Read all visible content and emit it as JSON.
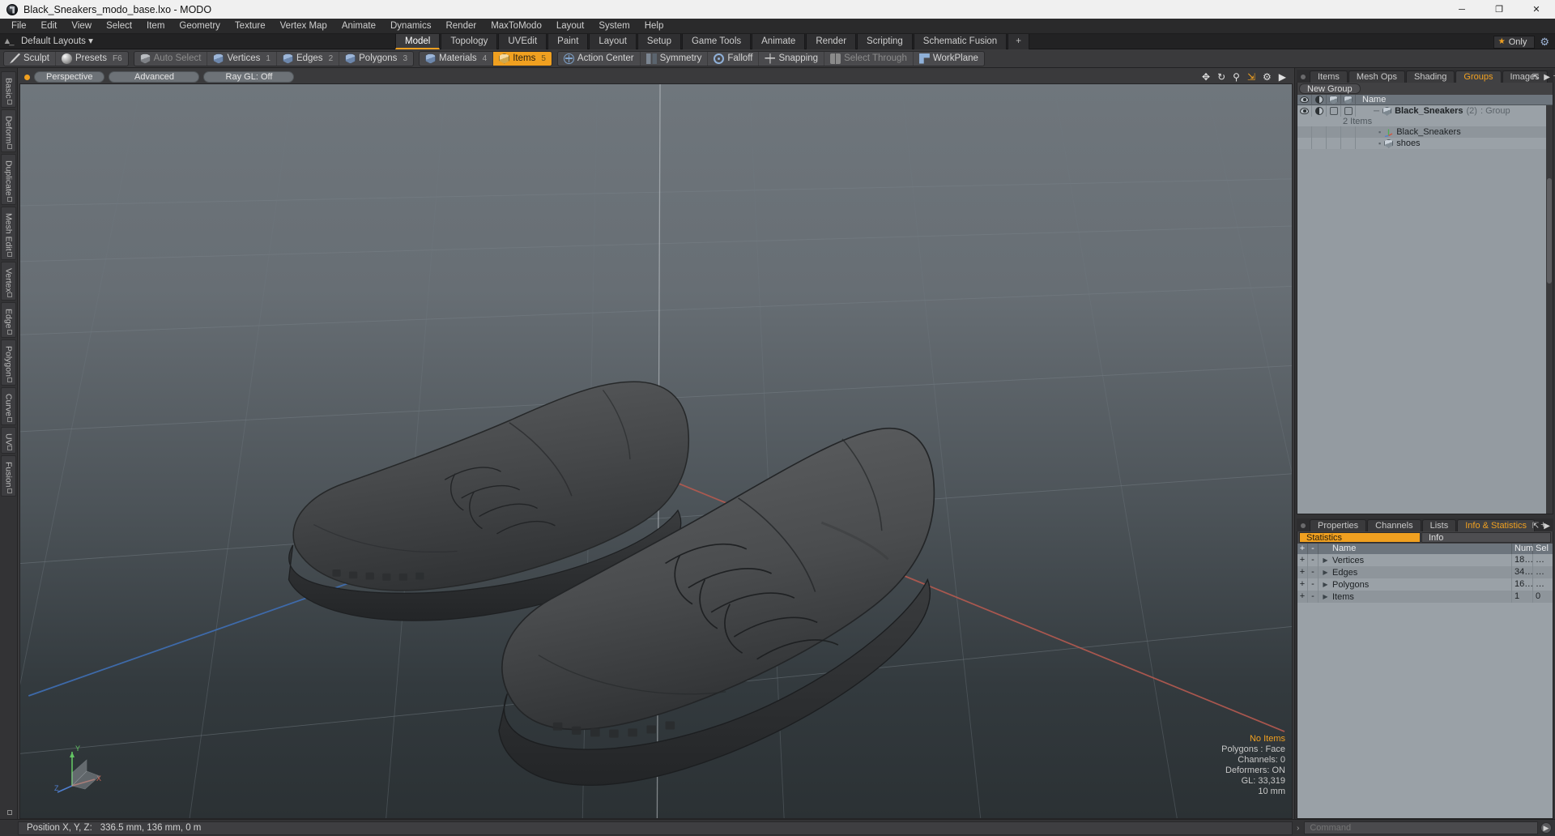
{
  "titlebar": {
    "title": "Black_Sneakers_modo_base.lxo - MODO",
    "app_icon": "modo-logo-icon",
    "minimize": "─",
    "maximize": "❐",
    "close": "✕"
  },
  "menubar": {
    "items": [
      "File",
      "Edit",
      "View",
      "Select",
      "Item",
      "Geometry",
      "Texture",
      "Vertex Map",
      "Animate",
      "Dynamics",
      "Render",
      "MaxToModo",
      "Layout",
      "System",
      "Help"
    ]
  },
  "layoutbar": {
    "home_icon": "home-icon",
    "preset_label": "Default Layouts",
    "chevron": "▾",
    "tabs": [
      {
        "label": "Model",
        "active": true
      },
      {
        "label": "Topology",
        "active": false
      },
      {
        "label": "UVEdit",
        "active": false
      },
      {
        "label": "Paint",
        "active": false
      },
      {
        "label": "Layout",
        "active": false
      },
      {
        "label": "Setup",
        "active": false
      },
      {
        "label": "Game Tools",
        "active": false
      },
      {
        "label": "Animate",
        "active": false
      },
      {
        "label": "Render",
        "active": false
      },
      {
        "label": "Scripting",
        "active": false
      },
      {
        "label": "Schematic Fusion",
        "active": false
      },
      {
        "label": "+",
        "active": false
      }
    ],
    "only_label": "Only",
    "star_icon": "star-icon",
    "gear_icon": "gear-icon"
  },
  "toolbar": {
    "groups": [
      {
        "buttons": [
          {
            "label": "Sculpt",
            "icon": "sculpt-pen-icon",
            "state": "normal",
            "num": ""
          },
          {
            "label": "Presets",
            "icon": "presets-sphere-icon",
            "state": "normal",
            "num": "F6"
          }
        ]
      },
      {
        "buttons": [
          {
            "label": "Auto Select",
            "icon": "auto-select-cube-icon",
            "state": "dim",
            "num": ""
          },
          {
            "label": "Vertices",
            "icon": "vertices-cube-icon",
            "state": "normal",
            "num": "1"
          },
          {
            "label": "Edges",
            "icon": "edges-cube-icon",
            "state": "normal",
            "num": "2"
          },
          {
            "label": "Polygons",
            "icon": "polygons-cube-icon",
            "state": "normal",
            "num": "3"
          }
        ]
      },
      {
        "buttons": [
          {
            "label": "Materials",
            "icon": "materials-cube-icon",
            "state": "normal",
            "num": "4"
          },
          {
            "label": "Items",
            "icon": "items-cube-icon",
            "state": "active",
            "num": "5"
          }
        ]
      },
      {
        "buttons": [
          {
            "label": "Action Center",
            "icon": "action-center-icon",
            "state": "normal",
            "num": ""
          },
          {
            "label": "Symmetry",
            "icon": "symmetry-icon",
            "state": "normal",
            "num": ""
          },
          {
            "label": "Falloff",
            "icon": "falloff-icon",
            "state": "normal",
            "num": ""
          },
          {
            "label": "Snapping",
            "icon": "snapping-icon",
            "state": "normal",
            "num": ""
          },
          {
            "label": "Select Through",
            "icon": "select-through-icon",
            "state": "dim",
            "num": ""
          },
          {
            "label": "WorkPlane",
            "icon": "workplane-icon",
            "state": "normal",
            "num": ""
          }
        ]
      }
    ]
  },
  "left_tabs": {
    "items": [
      "Basic",
      "Deform",
      "Duplicate",
      "Mesh Edit",
      "Vertex",
      "Edge",
      "Polygon",
      "Curve",
      "UV",
      "Fusion"
    ]
  },
  "viewport": {
    "dot_icon": "viewport-active-dot-icon",
    "pills": [
      "Perspective",
      "Advanced",
      "Ray GL: Off"
    ],
    "tools": [
      {
        "icon": "pan-icon",
        "accent": false
      },
      {
        "icon": "rotate-icon",
        "accent": false
      },
      {
        "icon": "zoom-magnifier-icon",
        "accent": false
      },
      {
        "icon": "fit-resize-icon",
        "accent": true
      },
      {
        "icon": "viewport-settings-gear-icon",
        "accent": false
      },
      {
        "icon": "viewport-menu-arrow-icon",
        "accent": false
      }
    ],
    "hud": {
      "no_items": "No Items",
      "polygons": "Polygons : Face",
      "channels": "Channels: 0",
      "deformers": "Deformers: ON",
      "gl": "GL: 33,319",
      "grid_size": "10 mm"
    },
    "gizmo": {
      "y_label": "Y",
      "x_label": "X",
      "z_label": "Z"
    },
    "scene_object": "black-sneakers-pair-3d-model"
  },
  "right_panel": {
    "tabs": [
      {
        "label": "Items",
        "active": false
      },
      {
        "label": "Mesh Ops",
        "active": false
      },
      {
        "label": "Shading",
        "active": false
      },
      {
        "label": "Groups",
        "active": true
      },
      {
        "label": "Images",
        "active": false
      },
      {
        "label": "+",
        "active": false
      }
    ],
    "expand_icon": "expand-panel-icon",
    "menu_icon": "panel-menu-arrow-icon",
    "new_group_label": "New Group",
    "tree_columns": {
      "eye_icon": "visibility-eye-icon",
      "shade_icon": "shading-half-circle-icon",
      "lock_icon": "wireframe-cube-icon",
      "select_icon": "selectable-cube-icon",
      "name": "Name"
    },
    "tree": [
      {
        "name": "Black_Sneakers",
        "count": "(2)",
        "type": ": Group",
        "icon": "group-cube-icon",
        "sub": "2 Items",
        "depth": 0,
        "bold": true
      },
      {
        "name": "Black_Sneakers",
        "count": "",
        "type": "",
        "icon": "locator-axis-icon",
        "sub": "",
        "depth": 1,
        "bold": false
      },
      {
        "name": "shoes",
        "count": "",
        "type": "",
        "icon": "mesh-cube-icon",
        "sub": "",
        "depth": 1,
        "bold": false
      }
    ]
  },
  "stats_panel": {
    "tabs": [
      {
        "label": "Properties",
        "active": false
      },
      {
        "label": "Channels",
        "active": false
      },
      {
        "label": "Lists",
        "active": false
      },
      {
        "label": "Info & Statistics",
        "active": true
      },
      {
        "label": "+",
        "active": false
      }
    ],
    "expand_icon": "expand-panel-icon",
    "menu_icon": "panel-menu-arrow-icon",
    "sub_tabs": [
      {
        "label": "Statistics",
        "active": true
      },
      {
        "label": "Info",
        "active": false
      }
    ],
    "columns": {
      "plus": "+",
      "minus": "-",
      "name": "Name",
      "num": "Num",
      "sel": "Sel"
    },
    "rows": [
      {
        "plus": "+",
        "minus": "-",
        "arrow": "▶",
        "name": "Vertices",
        "num": "18…",
        "sel": "…"
      },
      {
        "plus": "+",
        "minus": "-",
        "arrow": "▶",
        "name": "Edges",
        "num": "34…",
        "sel": "…"
      },
      {
        "plus": "+",
        "minus": "-",
        "arrow": "▶",
        "name": "Polygons",
        "num": "16…",
        "sel": "…"
      },
      {
        "plus": "+",
        "minus": "-",
        "arrow": "▶",
        "name": "Items",
        "num": "1",
        "sel": "0"
      }
    ]
  },
  "bottombar": {
    "position_label": "Position X, Y, Z:",
    "position_value": "336.5 mm, 136 mm, 0 m",
    "command_caret": "›",
    "command_placeholder": "Command",
    "command_go_icon": "command-execute-icon"
  },
  "colors": {
    "accent": "#f0a020",
    "panel_bg": "#414143",
    "tree_bg": "#949ba1",
    "titlebar_bg": "#f0f0f0",
    "axis_x": "#b55a50",
    "axis_z": "#3f6fb5"
  }
}
